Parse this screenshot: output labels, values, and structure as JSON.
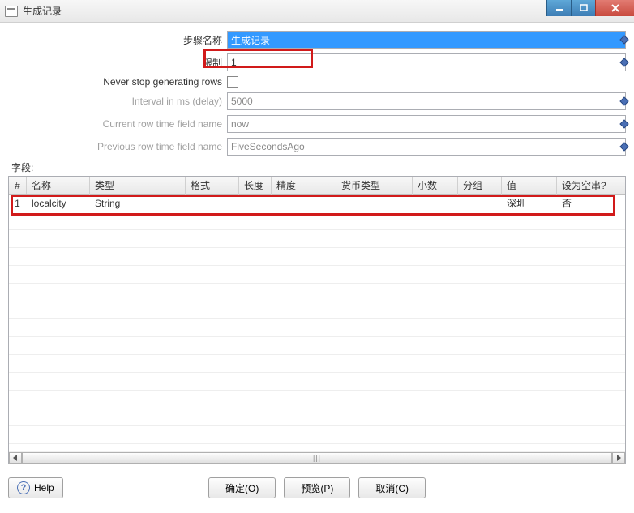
{
  "window": {
    "title": "生成记录"
  },
  "form": {
    "step_name_label": "步骤名称",
    "step_name_value": "生成记录",
    "limit_label": "限制",
    "limit_value": "1",
    "never_stop_label": "Never stop generating rows",
    "interval_label": "Interval in ms (delay)",
    "interval_value": "5000",
    "current_time_label": "Current row time field name",
    "current_time_value": "now",
    "previous_time_label": "Previous row time field name",
    "previous_time_value": "FiveSecondsAgo"
  },
  "fields_section_label": "字段:",
  "table": {
    "headers": {
      "num": "#",
      "name": "名称",
      "type": "类型",
      "format": "格式",
      "length": "长度",
      "precision": "精度",
      "currency": "货币类型",
      "decimal": "小数",
      "group": "分组",
      "value": "值",
      "null": "设为空串?"
    },
    "rows": [
      {
        "num": "1",
        "name": "localcity",
        "type": "String",
        "format": "",
        "length": "",
        "precision": "",
        "currency": "",
        "decimal": "",
        "group": "",
        "value": "深圳",
        "null": "否"
      }
    ]
  },
  "buttons": {
    "help": "Help",
    "ok": "确定(O)",
    "preview": "预览(P)",
    "cancel": "取消(C)"
  }
}
